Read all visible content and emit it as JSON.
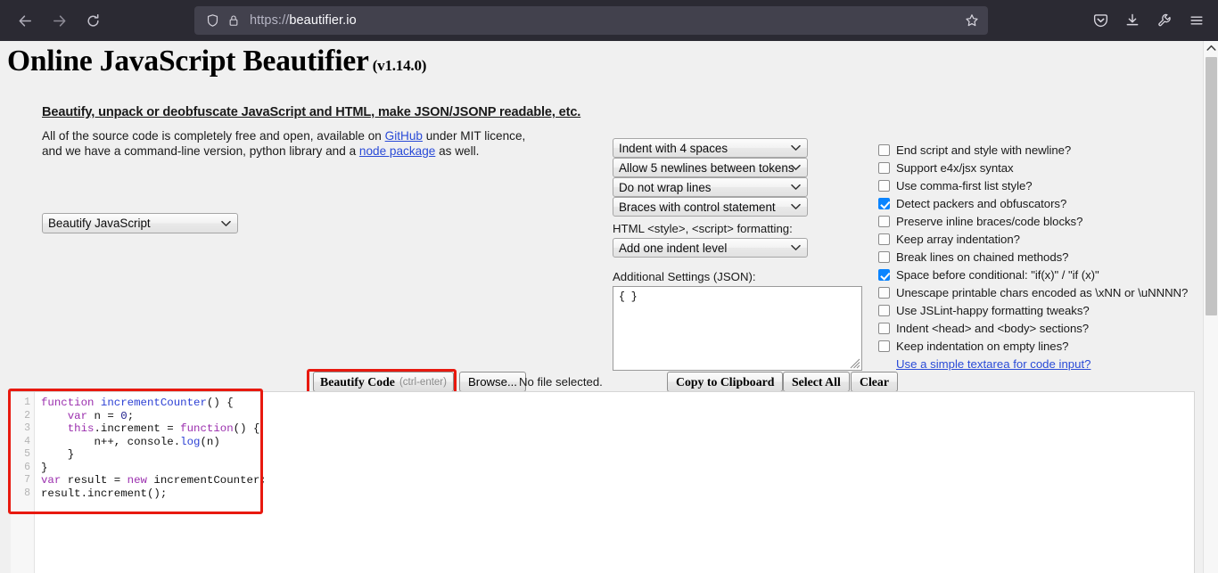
{
  "browser": {
    "nav": {
      "back": "back-arrow",
      "forward": "forward-arrow",
      "reload": "reload"
    },
    "url_scheme": "https://",
    "url_host": "beautifier.io",
    "url_full": "https://beautifier.io",
    "icons": {
      "shield": "tracking-protection-shield",
      "lock": "connection-lock",
      "bookmark": "bookmark-star",
      "pocket": "save-to-pocket",
      "downloads": "downloads",
      "tools": "browser-tools-wrench",
      "menu": "application-menu"
    }
  },
  "page": {
    "title": "Online JavaScript Beautifier",
    "version": "(v1.14.0)",
    "intro_headline": "Beautify, unpack or deobfuscate JavaScript and HTML, make JSON/JSONP readable, etc.",
    "intro_line1_a": "All of the source code is completely free and open, available on ",
    "intro_link_github": "GitHub",
    "intro_line1_b": " under MIT licence,",
    "intro_line2_a": "and we have a command-line version, python library and a ",
    "intro_link_node": "node package",
    "intro_line2_b": " as well.",
    "mode_select_value": "Beautify JavaScript"
  },
  "options": {
    "indent_value": "Indent with 4 spaces",
    "newlines_value": "Allow 5 newlines between tokens",
    "wrap_value": "Do not wrap lines",
    "braces_value": "Braces with control statement",
    "html_format_label": "HTML <style>, <script> formatting:",
    "html_format_value": "Add one indent level",
    "additional_settings_label": "Additional Settings (JSON):",
    "additional_settings_value": "{ }"
  },
  "checkboxes": [
    {
      "label": "End script and style with newline?",
      "checked": false
    },
    {
      "label": "Support e4x/jsx syntax",
      "checked": false
    },
    {
      "label": "Use comma-first list style?",
      "checked": false
    },
    {
      "label": "Detect packers and obfuscators?",
      "checked": true
    },
    {
      "label": "Preserve inline braces/code blocks?",
      "checked": false
    },
    {
      "label": "Keep array indentation?",
      "checked": false
    },
    {
      "label": "Break lines on chained methods?",
      "checked": false
    },
    {
      "label": "Space before conditional: \"if(x)\" / \"if (x)\"",
      "checked": true
    },
    {
      "label": "Unescape printable chars encoded as \\xNN or \\uNNNN?",
      "checked": false
    },
    {
      "label": "Use JSLint-happy formatting tweaks?",
      "checked": false
    },
    {
      "label": "Indent <head> and <body> sections?",
      "checked": false
    },
    {
      "label": "Keep indentation on empty lines?",
      "checked": false
    }
  ],
  "simple_textarea_link": "Use a simple textarea for code input?",
  "buttons": {
    "beautify": "Beautify Code",
    "beautify_hint": "(ctrl-enter)",
    "browse": "Browse...",
    "no_file": "No file selected.",
    "copy": "Copy to Clipboard",
    "select_all": "Select All",
    "clear": "Clear"
  },
  "editor": {
    "line_numbers": [
      "1",
      "2",
      "3",
      "4",
      "5",
      "6",
      "7",
      "8"
    ],
    "code_text": "function incrementCounter() {\n    var n = 0;\n    this.increment = function() {\n        n++, console.log(n)\n    }\n}\nvar result = new incrementCounter;\nresult.increment();",
    "lines": [
      [
        {
          "t": "function ",
          "c": "kw"
        },
        {
          "t": "incrementCounter",
          "c": "fn"
        },
        {
          "t": "() {",
          "c": "var"
        }
      ],
      [
        {
          "t": "    ",
          "c": "var"
        },
        {
          "t": "var",
          "c": "kw"
        },
        {
          "t": " n = ",
          "c": "var"
        },
        {
          "t": "0",
          "c": "num"
        },
        {
          "t": ";",
          "c": "var"
        }
      ],
      [
        {
          "t": "    ",
          "c": "var"
        },
        {
          "t": "this",
          "c": "kw"
        },
        {
          "t": ".increment = ",
          "c": "var"
        },
        {
          "t": "function",
          "c": "kw"
        },
        {
          "t": "() {",
          "c": "var"
        }
      ],
      [
        {
          "t": "        n++, console.",
          "c": "var"
        },
        {
          "t": "log",
          "c": "fn"
        },
        {
          "t": "(n)",
          "c": "var"
        }
      ],
      [
        {
          "t": "    }",
          "c": "var"
        }
      ],
      [
        {
          "t": "}",
          "c": "var"
        }
      ],
      [
        {
          "t": "var",
          "c": "kw"
        },
        {
          "t": " result = ",
          "c": "var"
        },
        {
          "t": "new",
          "c": "kw"
        },
        {
          "t": " incrementCounter;",
          "c": "var"
        }
      ],
      [
        {
          "t": "result.increment();",
          "c": "var"
        }
      ]
    ]
  },
  "colors": {
    "highlight_red": "#e8190f",
    "checkbox_accent": "#0a84ff",
    "link_blue": "#2a4bd7",
    "chrome_bg": "#2b2a33",
    "urlbar_bg": "#42414d",
    "page_bg": "#f0f0f0"
  },
  "scrollbar": {
    "up_arrow": "scroll-up-arrow"
  }
}
